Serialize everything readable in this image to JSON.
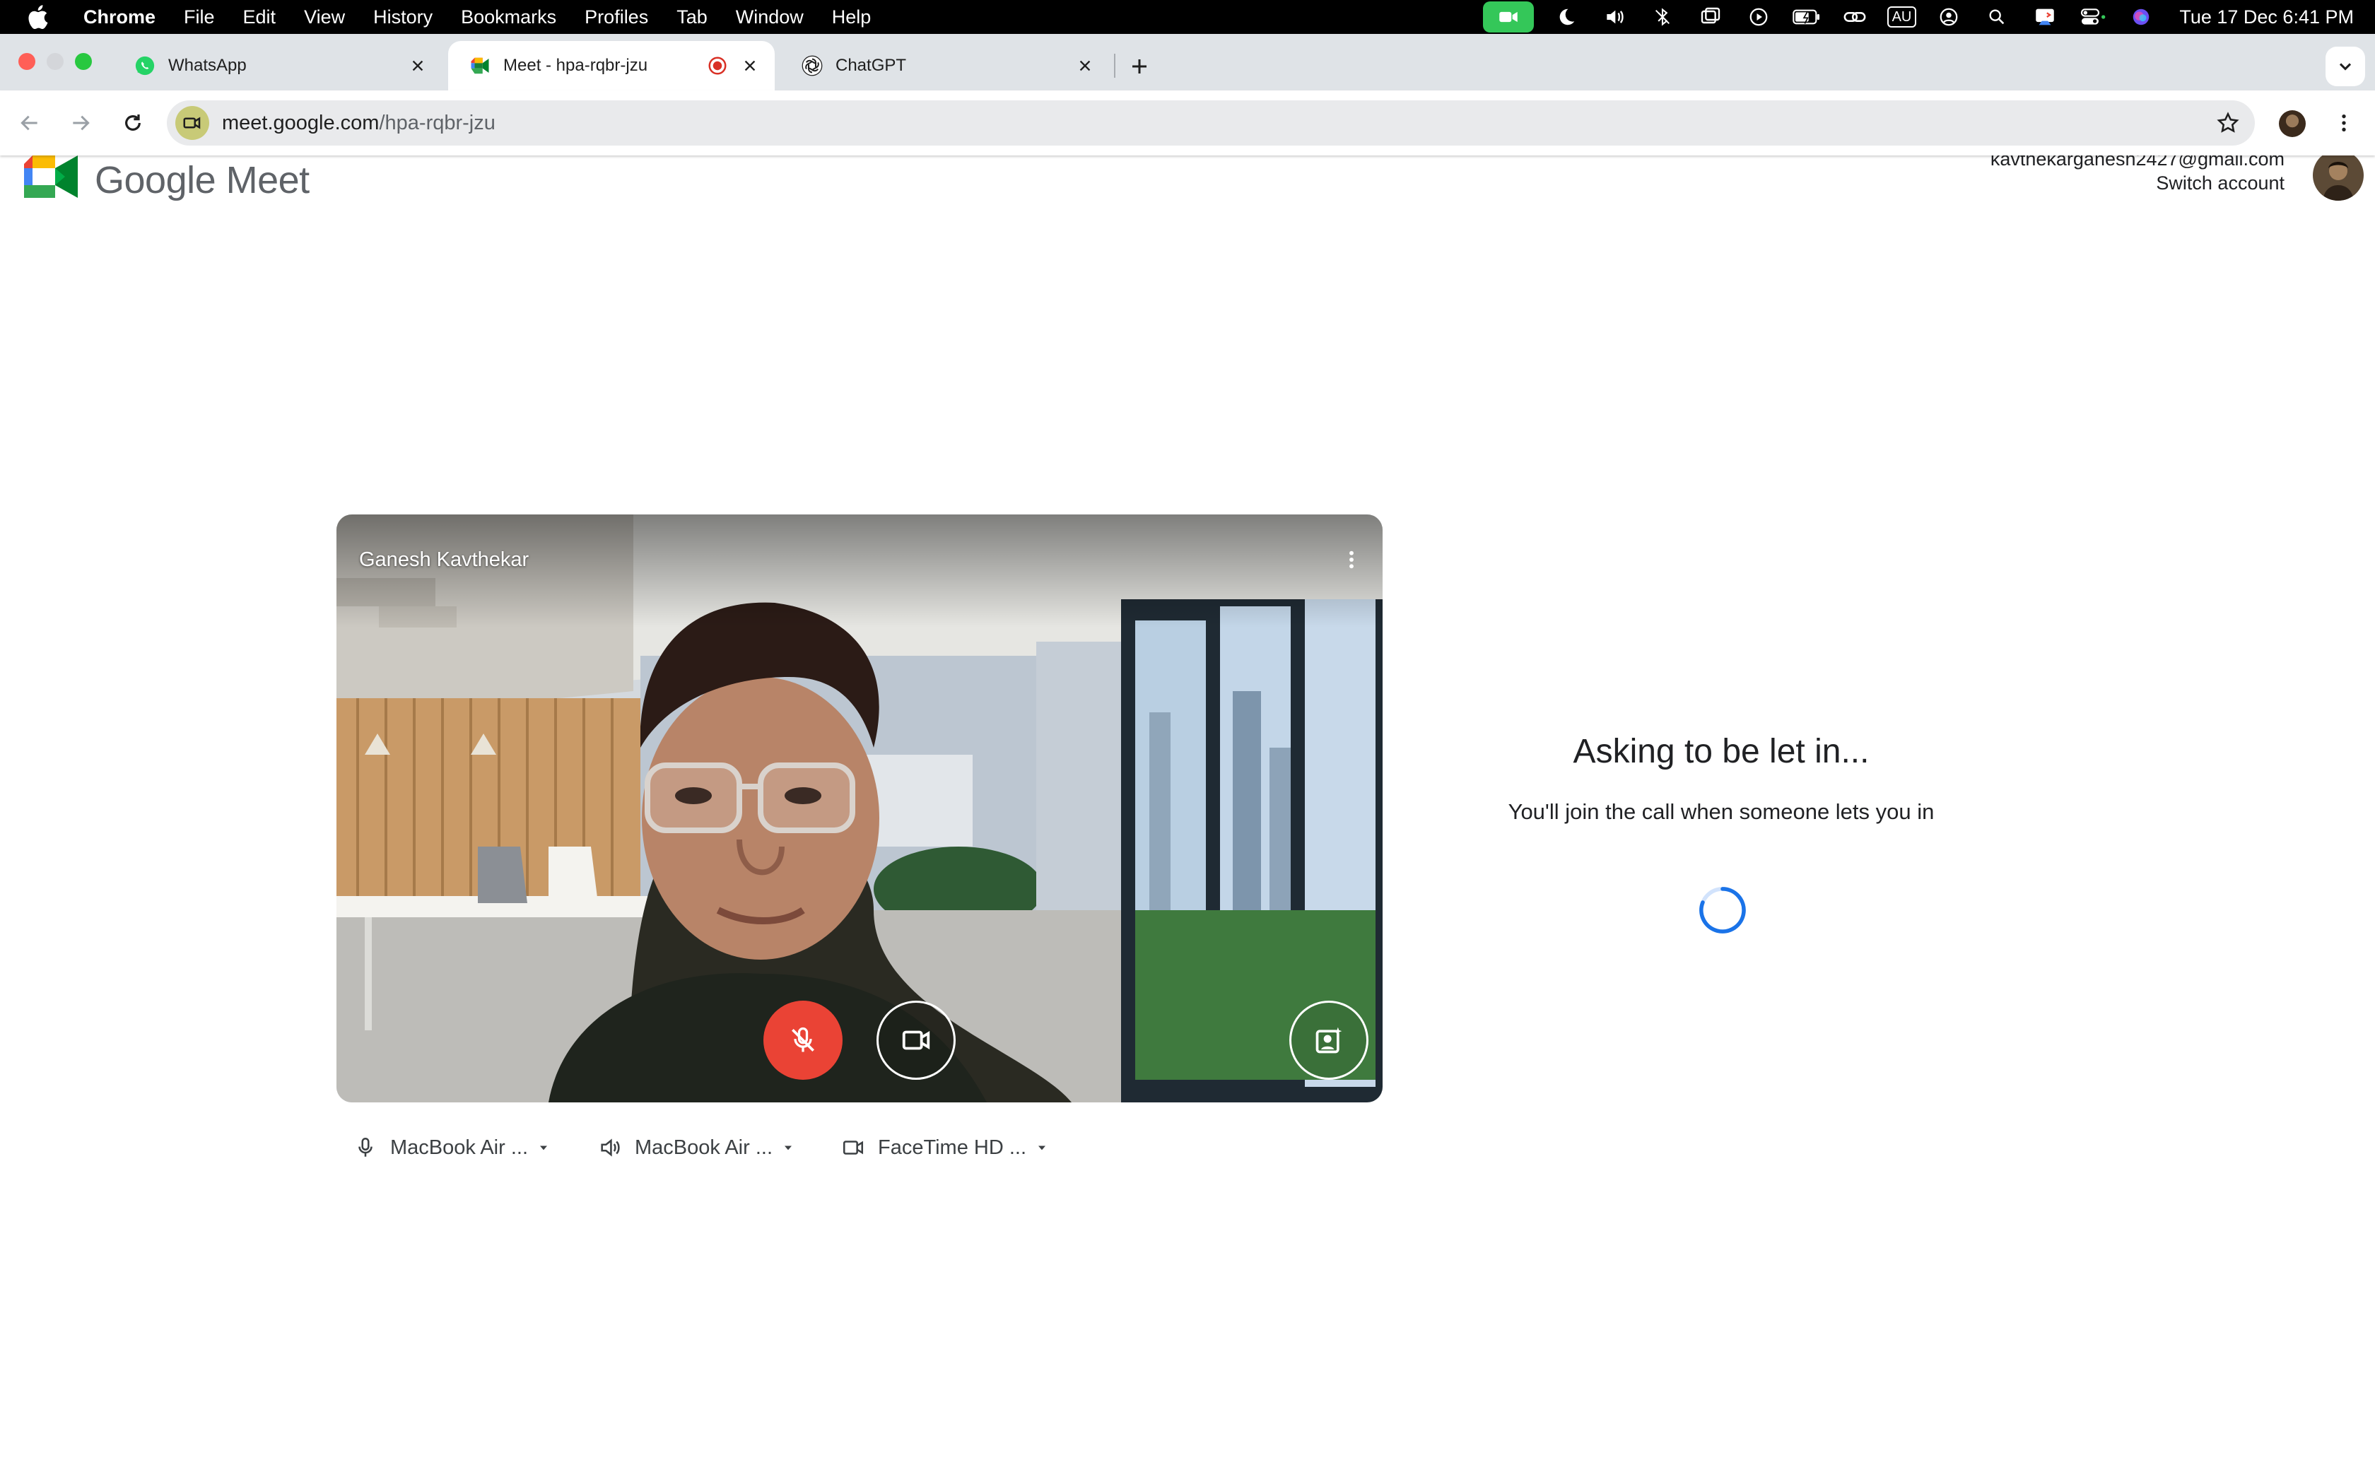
{
  "menubar": {
    "app": "Chrome",
    "items": [
      "File",
      "Edit",
      "View",
      "History",
      "Bookmarks",
      "Profiles",
      "Tab",
      "Window",
      "Help"
    ],
    "status_icons": [
      "facetime-camera-icon",
      "moon-icon",
      "volume-icon",
      "bluetooth-icon",
      "screen-mirroring-icon",
      "play-icon",
      "battery-icon",
      "link-icon",
      "input-source-icon",
      "user-icon",
      "spotlight-search-icon",
      "screen-share-icon",
      "control-center-icon",
      "siri-icon"
    ],
    "input_source": "AU",
    "clock": "Tue 17 Dec  6:41 PM"
  },
  "tabs": [
    {
      "title": "WhatsApp",
      "icon": "whatsapp-icon",
      "active": false
    },
    {
      "title": "Meet - hpa-rqbr-jzu",
      "icon": "google-meet-icon",
      "active": true,
      "recording": true
    },
    {
      "title": "ChatGPT",
      "icon": "chatgpt-icon",
      "active": false
    }
  ],
  "toolbar": {
    "url_host": "meet.google.com",
    "url_path": "/hpa-rqbr-jzu"
  },
  "meet": {
    "brand": "Google Meet",
    "account_email": "kavthekarganesh2427@gmail.com",
    "switch_account": "Switch account",
    "participant_name": "Ganesh Kavthekar",
    "mic_muted": true,
    "devices": [
      {
        "icon": "microphone-icon",
        "label": "MacBook Air ..."
      },
      {
        "icon": "speaker-icon",
        "label": "MacBook Air ..."
      },
      {
        "icon": "camera-icon",
        "label": "FaceTime HD ..."
      }
    ],
    "status_title": "Asking to be let in...",
    "status_subtitle": "You'll join the call when someone lets you in"
  },
  "colors": {
    "menubar_bg": "#000000",
    "tabstrip_bg": "#dfe3e7",
    "omnibox_bg": "#e9eaec",
    "mic_muted": "#ea4335",
    "spinner": "#1a73e8",
    "facetime_active": "#34c759"
  }
}
